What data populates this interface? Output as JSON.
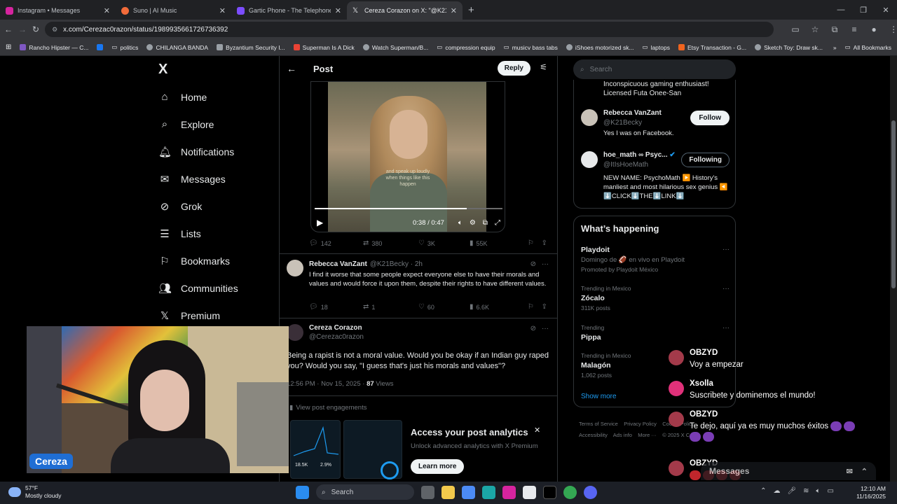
{
  "browser": {
    "tabs": [
      {
        "title": "Instagram • Messages",
        "color": "#d6249f",
        "active": false
      },
      {
        "title": "Suno | AI Music",
        "color": "#f26b3a",
        "active": false
      },
      {
        "title": "Gartic Phone - The Telephone Game",
        "color": "#7c4dff",
        "active": false
      },
      {
        "title": "Cereza Corazon on X: \"@K21Becky",
        "color": "#e8eaed",
        "active": true
      }
    ],
    "url": "x.com/Cerezac0razon/status/1989935661726736392",
    "bookmarks": [
      {
        "label": "Rancho Hipster — C...",
        "color": "#7e57c2"
      },
      {
        "label": "politics",
        "color": "#1877f2"
      },
      {
        "label": "CHILANGA BANDA",
        "color": "#9aa0a6"
      },
      {
        "label": "Byzantium Security I...",
        "color": "#9aa0a6"
      },
      {
        "label": "Superman Is A Dick",
        "color": "#ea4335"
      },
      {
        "label": "Watch Superman/B...",
        "color": "#9aa0a6"
      },
      {
        "label": "compression equip",
        "color": "#9aa0a6"
      },
      {
        "label": "musicv bass tabs",
        "color": "#9aa0a6"
      },
      {
        "label": "iShoes motorized sk...",
        "color": "#9aa0a6"
      },
      {
        "label": "laptops",
        "color": "#9aa0a6"
      },
      {
        "label": "Etsy Transaction - G...",
        "color": "#f1641e"
      },
      {
        "label": "Sketch Toy: Draw sk...",
        "color": "#9aa0a6"
      }
    ],
    "all_bookmarks": "All Bookmarks"
  },
  "nav": {
    "logo": "X",
    "items": [
      "Home",
      "Explore",
      "Notifications",
      "Messages",
      "Grok",
      "Lists",
      "Bookmarks",
      "Communities",
      "Premium"
    ]
  },
  "post": {
    "header": "Post",
    "reply_button": "Reply",
    "video": {
      "subtitle": "and speak up loudly when things like this happen",
      "time": "0:38 / 0:47",
      "progress": 0.81
    },
    "stats": {
      "replies": "142",
      "reposts": "380",
      "likes": "3K",
      "views": "55K"
    }
  },
  "reply1": {
    "name": "Rebecca VanZant",
    "handle": "@K21Becky · 2h",
    "text": "I find it worse that some people expect everyone else to have their morals and values and would force it upon them, despite their rights to have different values.",
    "stats": {
      "replies": "18",
      "reposts": "1",
      "likes": "60",
      "views": "6.6K"
    }
  },
  "reply2": {
    "name": "Cereza Corazon",
    "handle": "@Cerezac0razon",
    "text": "Being a rapist is not a moral value. Would you be okay if an Indian guy raped you? Would you say, \"I guess that's just his morals and values\"?",
    "timestamp": "12:56 PM · Nov 15, 2025 · ",
    "views_count": "87",
    "views_label": " Views",
    "engagements": "View post engagements"
  },
  "promo": {
    "title": "Access your post analytics",
    "subtitle": "Unlock advanced analytics with X Premium",
    "button": "Learn more",
    "stat1": "18.5K",
    "stat2": "2.9%"
  },
  "right": {
    "search_placeholder": "Search",
    "bio_top": "Inconspicuous gaming enthusiast! Licensed Futa Onee-San",
    "follow": [
      {
        "name": "Rebecca VanZant",
        "handle": "@K21Becky",
        "bio": "Yes I was on Facebook.",
        "button": "Follow"
      },
      {
        "name": "hoe_math ∞ Psyc...",
        "handle": "@ItIsHoeMath",
        "bio": "NEW NAME: PsychoMath ▶️ History's manliest and most hilarious sex genius ◀️ ⬇️CLICK⬇️THE⬇️LINK⬇️",
        "button": "Following"
      }
    ],
    "happening_title": "What’s happening",
    "trends": [
      {
        "meta": "",
        "name": "Playdoit",
        "sub": "Domingo de 🏈 en vivo en Playdoit",
        "extra": "Promoted by Playdoit México"
      },
      {
        "meta": "Trending in Mexico",
        "name": "Zócalo",
        "sub": "311K posts",
        "extra": ""
      },
      {
        "meta": "Trending",
        "name": "Pippa",
        "sub": "",
        "extra": ""
      },
      {
        "meta": "Trending in Mexico",
        "name": "Malagón",
        "sub": "1,062 posts",
        "extra": ""
      }
    ],
    "show_more": "Show more",
    "footer": [
      "Terms of Service",
      "Privacy Policy",
      "Cookie Policy",
      "Accessibility",
      "Ads info",
      "More ···",
      "© 2025 X Corp."
    ]
  },
  "webcam": {
    "label": "Cereza"
  },
  "chat": [
    {
      "name": "OBZYD",
      "text": "Voy a empezar",
      "color": "#a33a4a"
    },
    {
      "name": "Xsolla",
      "text": "Suscribete y dominemos el mundo!",
      "color": "#e0317a"
    },
    {
      "name": "OBZYD",
      "text": "Te dejo, aquí ya es muy muchos éxitos",
      "color": "#a33a4a"
    },
    {
      "name": "OBZYD",
      "text": "",
      "color": "#a33a4a"
    }
  ],
  "messages_dock": "Messages",
  "taskbar": {
    "temp": "57°F",
    "condition": "Mostly cloudy",
    "search": "Search",
    "time": "12:10 AM",
    "date": "11/16/2025"
  }
}
